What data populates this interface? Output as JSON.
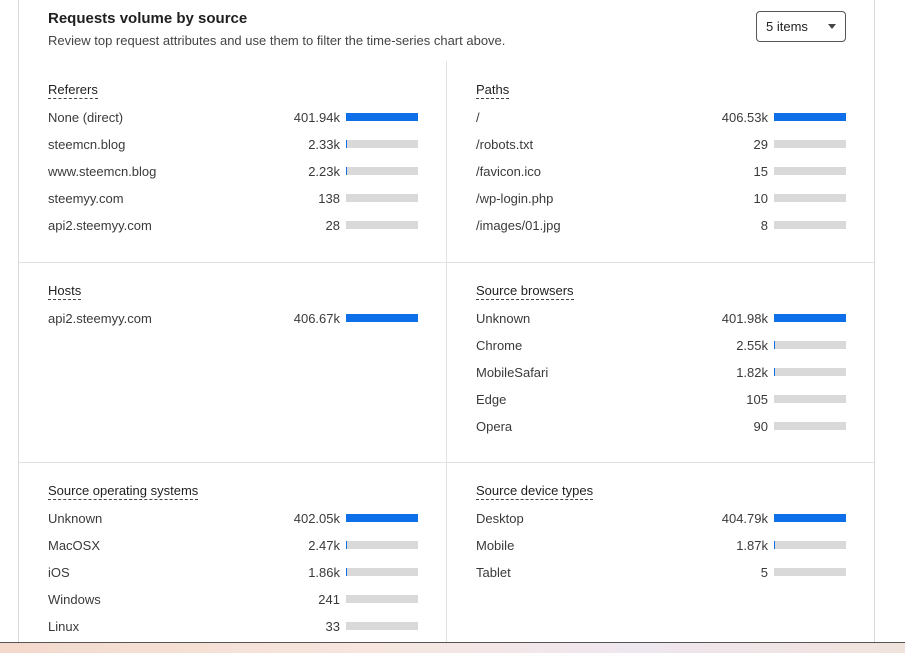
{
  "header": {
    "title": "Requests volume by source",
    "subtitle": "Review top request attributes and use them to filter the time-series chart above."
  },
  "items_select": {
    "value": "5 items"
  },
  "sections": [
    {
      "title": "Referers",
      "rows": [
        {
          "label": "None (direct)",
          "value": "401.94k",
          "fraction": 1.0
        },
        {
          "label": "steemcn.blog",
          "value": "2.33k",
          "fraction": 0.006
        },
        {
          "label": "www.steemcn.blog",
          "value": "2.23k",
          "fraction": 0.006
        },
        {
          "label": "steemyy.com",
          "value": "138",
          "fraction": 0
        },
        {
          "label": "api2.steemyy.com",
          "value": "28",
          "fraction": 0
        }
      ]
    },
    {
      "title": "Paths",
      "rows": [
        {
          "label": "/",
          "value": "406.53k",
          "fraction": 1.0
        },
        {
          "label": "/robots.txt",
          "value": "29",
          "fraction": 0
        },
        {
          "label": "/favicon.ico",
          "value": "15",
          "fraction": 0
        },
        {
          "label": "/wp-login.php",
          "value": "10",
          "fraction": 0
        },
        {
          "label": "/images/01.jpg",
          "value": "8",
          "fraction": 0
        }
      ]
    },
    {
      "title": "Hosts",
      "rows": [
        {
          "label": "api2.steemyy.com",
          "value": "406.67k",
          "fraction": 1.0
        }
      ]
    },
    {
      "title": "Source browsers",
      "rows": [
        {
          "label": "Unknown",
          "value": "401.98k",
          "fraction": 1.0
        },
        {
          "label": "Chrome",
          "value": "2.55k",
          "fraction": 0.006
        },
        {
          "label": "MobileSafari",
          "value": "1.82k",
          "fraction": 0.005
        },
        {
          "label": "Edge",
          "value": "105",
          "fraction": 0
        },
        {
          "label": "Opera",
          "value": "90",
          "fraction": 0
        }
      ]
    },
    {
      "title": "Source operating systems",
      "rows": [
        {
          "label": "Unknown",
          "value": "402.05k",
          "fraction": 1.0
        },
        {
          "label": "MacOSX",
          "value": "2.47k",
          "fraction": 0.006
        },
        {
          "label": "iOS",
          "value": "1.86k",
          "fraction": 0.005
        },
        {
          "label": "Windows",
          "value": "241",
          "fraction": 0
        },
        {
          "label": "Linux",
          "value": "33",
          "fraction": 0
        }
      ]
    },
    {
      "title": "Source device types",
      "rows": [
        {
          "label": "Desktop",
          "value": "404.79k",
          "fraction": 1.0
        },
        {
          "label": "Mobile",
          "value": "1.87k",
          "fraction": 0.005
        },
        {
          "label": "Tablet",
          "value": "5",
          "fraction": 0
        }
      ]
    }
  ],
  "colors": {
    "bar_fill": "#0f6fe8",
    "bar_track": "#d9d9d9"
  }
}
